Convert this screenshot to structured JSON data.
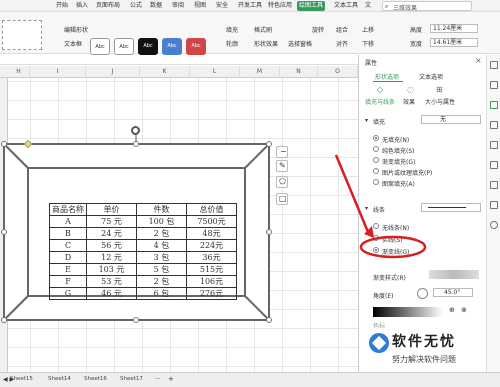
{
  "ribbon_tabs": [
    "开始",
    "插入",
    "页面布局",
    "公式",
    "数据",
    "审阅",
    "视图",
    "安全",
    "开发工具",
    "特色应用",
    "绘图工具",
    "文本工具",
    "文"
  ],
  "search_placeholder": "三维效果",
  "ribbon": {
    "edit_shape": "编辑形状",
    "text_box": "文本框",
    "fill": "填充",
    "outline": "轮廓",
    "format_brush": "格式刷",
    "shape_effect": "形状效果",
    "select_pane": "选择窗格",
    "rotate": "旋转",
    "combine": "组合",
    "align": "对齐",
    "move_up": "上移",
    "move_down": "下移",
    "height_label": "高度",
    "width_label": "宽度",
    "height_value": "11.24厘米",
    "width_value": "14.61厘米",
    "style_swatches": [
      "Abc",
      "Abc",
      "Abc",
      "Abc",
      "Abc"
    ],
    "swatch_colors": [
      "#ffffff",
      "#ffffff",
      "#111111",
      "#4a7fd0",
      "#d04545"
    ]
  },
  "columns": [
    "H",
    "I",
    "J",
    "K",
    "L",
    "M",
    "N",
    "O"
  ],
  "pane": {
    "title": "属性",
    "tabs": [
      "形状选项",
      "文本选项"
    ],
    "subtabs": [
      "填充与线条",
      "效果",
      "大小与属性"
    ],
    "fill_section": "填充",
    "fill_value": "无",
    "fill_options": [
      "无填充(N)",
      "纯色填充(S)",
      "渐变填充(G)",
      "图片或纹理填充(P)",
      "图案填充(A)"
    ],
    "line_section": "线条",
    "line_options": [
      "无线条(N)",
      "实线(S)",
      "渐变线(G)"
    ],
    "gradient_style": "渐变样式(R)",
    "angle_label": "角度(E)",
    "angle_value": "45.0°",
    "gradient_stops": "色标"
  },
  "table": {
    "headers": [
      "商品名称",
      "单价",
      "件数",
      "总价值"
    ],
    "rows": [
      [
        "A",
        "75 元",
        "100 包",
        "7500元"
      ],
      [
        "B",
        "24 元",
        "2 包",
        "48元"
      ],
      [
        "C",
        "56 元",
        "4 包",
        "224元"
      ],
      [
        "D",
        "12 元",
        "3 包",
        "36元"
      ],
      [
        "E",
        "103 元",
        "5 包",
        "515元"
      ],
      [
        "F",
        "53 元",
        "2 包",
        "106元"
      ],
      [
        "G",
        "46 元",
        "6 包",
        "276元"
      ]
    ]
  },
  "sheets": [
    "Sheet15",
    "Sheet14",
    "Sheet16",
    "Sheet17"
  ],
  "watermark": {
    "title": "软件无忧",
    "subtitle": "努力解决软件问题"
  },
  "colors": {
    "accent": "#3b9a5b",
    "arrow": "#d81e1e",
    "radio": "#2a6ad8"
  }
}
